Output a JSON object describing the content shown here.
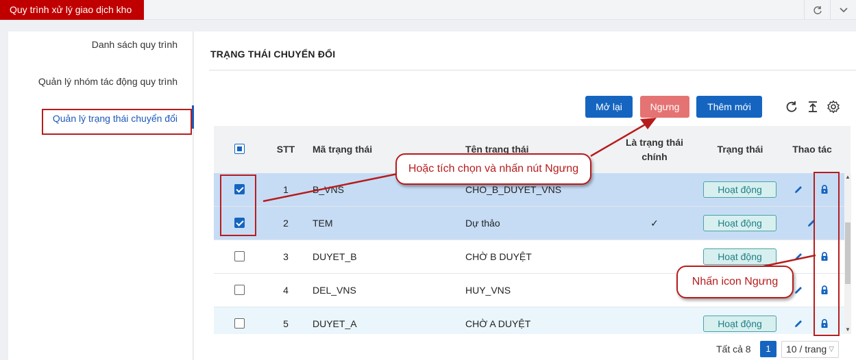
{
  "app": {
    "tab_title": "Quy trình xử lý giao dịch kho"
  },
  "topbar": {
    "refresh_icon": "refresh-icon",
    "dropdown_icon": "chevron-down-icon"
  },
  "sidebar": {
    "items": [
      {
        "label": "Danh sách quy trình",
        "active": false
      },
      {
        "label": "Quản lý nhóm tác động quy trình",
        "active": false
      },
      {
        "label": "Quản lý trạng thái chuyển đổi",
        "active": true
      }
    ]
  },
  "main": {
    "title": "TRẠNG THÁI CHUYỂN ĐỔI",
    "buttons": {
      "reopen": "Mở lại",
      "stop": "Ngưng",
      "add_new": "Thêm mới"
    },
    "tool_icons": [
      "reload-icon",
      "export-icon",
      "settings-icon"
    ]
  },
  "table": {
    "headers": {
      "stt": "STT",
      "code": "Mã trạng thái",
      "name": "Tên trạng thái",
      "is_main_1": "Là trạng thái",
      "is_main_2": "chính",
      "status": "Trạng thái",
      "actions": "Thao tác"
    },
    "rows": [
      {
        "stt": "1",
        "code": "B_VNS",
        "name": "CHO_B_DUYET_VNS",
        "is_main": "",
        "status": "Hoạt động",
        "checked": true,
        "has_lock": true
      },
      {
        "stt": "2",
        "code": "TEM",
        "name": "Dự thảo",
        "is_main": "✓",
        "status": "Hoạt động",
        "checked": true,
        "has_lock": false
      },
      {
        "stt": "3",
        "code": "DUYET_B",
        "name": "CHỜ B DUYỆT",
        "is_main": "",
        "status": "Hoạt động",
        "checked": false,
        "has_lock": true
      },
      {
        "stt": "4",
        "code": "DEL_VNS",
        "name": "HUY_VNS",
        "is_main": "",
        "status": "",
        "checked": false,
        "has_lock": true
      },
      {
        "stt": "5",
        "code": "DUYET_A",
        "name": "CHỜ A DUYỆT",
        "is_main": "",
        "status": "Hoạt động",
        "checked": false,
        "has_lock": true
      }
    ]
  },
  "pagination": {
    "total": "Tất cả 8",
    "current_page": "1",
    "page_size": "10 / trang"
  },
  "annotations": {
    "callout_stop_button": "Hoặc tích chọn và nhấn nút Ngưng",
    "callout_stop_icon": "Nhấn icon Ngưng"
  },
  "colors": {
    "brand_red": "#c00000",
    "primary": "#1565c0",
    "stop_button": "#e57373",
    "annotation": "#b71c1c",
    "badge": "#d7efef"
  }
}
